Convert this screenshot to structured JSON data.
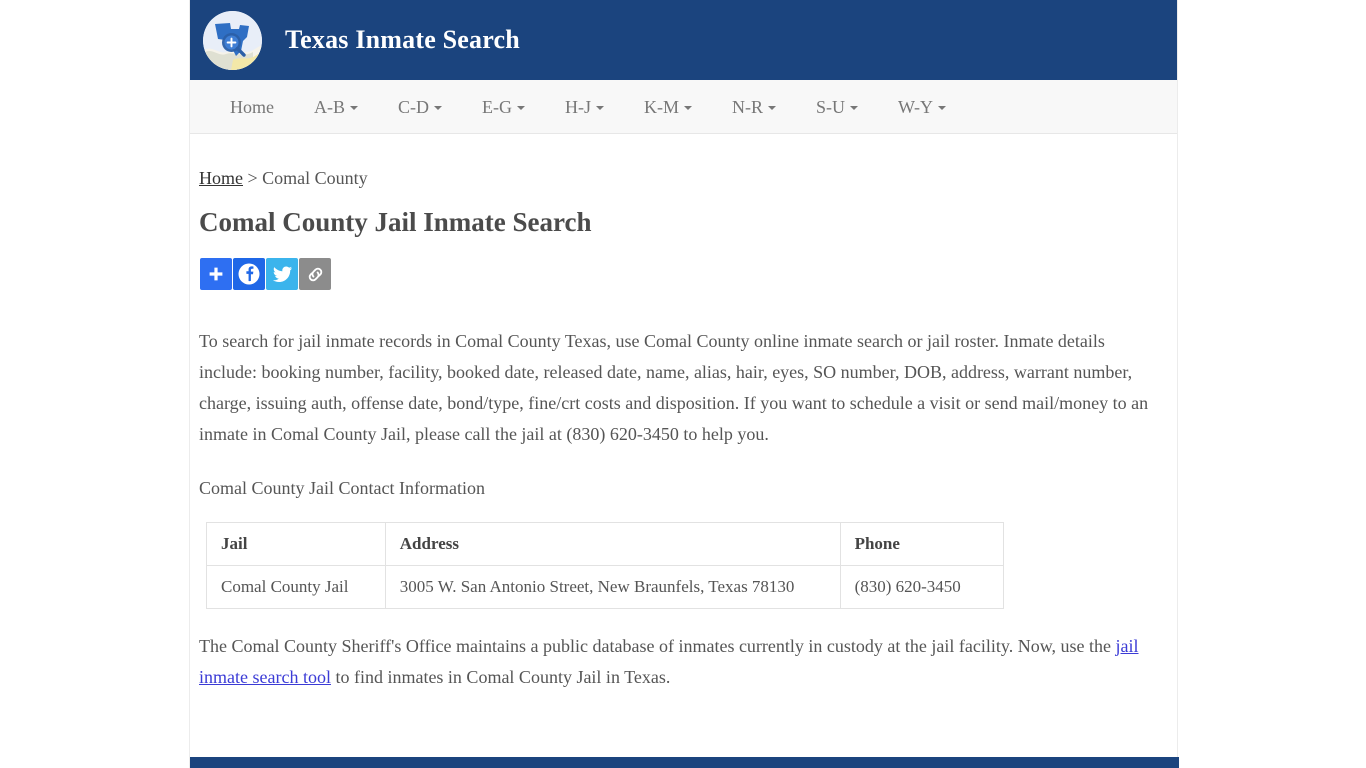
{
  "site": {
    "title": "Texas Inmate Search",
    "logo_icon": "texas-map-magnifier-icon",
    "brand_color": "#1b447e"
  },
  "nav": {
    "items": [
      {
        "label": "Home",
        "has_caret": false
      },
      {
        "label": "A-B",
        "has_caret": true
      },
      {
        "label": "C-D",
        "has_caret": true
      },
      {
        "label": "E-G",
        "has_caret": true
      },
      {
        "label": "H-J",
        "has_caret": true
      },
      {
        "label": "K-M",
        "has_caret": true
      },
      {
        "label": "N-R",
        "has_caret": true
      },
      {
        "label": "S-U",
        "has_caret": true
      },
      {
        "label": "W-Y",
        "has_caret": true
      }
    ]
  },
  "breadcrumb": {
    "home_label": "Home",
    "separator": " > ",
    "current": "Comal County"
  },
  "page": {
    "title": "Comal County Jail Inmate Search"
  },
  "share": {
    "buttons": [
      {
        "name": "addthis-share-button",
        "icon": "plus-icon",
        "color": "#2e6ff2"
      },
      {
        "name": "facebook-share-button",
        "icon": "facebook-icon",
        "color": "#1f67e7"
      },
      {
        "name": "twitter-share-button",
        "icon": "twitter-icon",
        "color": "#3bb4ec"
      },
      {
        "name": "copy-link-button",
        "icon": "chain-link-icon",
        "color": "#8c8c8c"
      }
    ]
  },
  "intro": {
    "paragraph": "To search for jail inmate records in Comal County Texas, use Comal County online inmate search or jail roster. Inmate details include: booking number, facility, booked date, released date, name, alias, hair, eyes, SO number, DOB, address, warrant number, charge, issuing auth, offense date, bond/type, fine/crt costs and disposition. If you want to schedule a visit or send mail/money to an inmate in Comal County Jail, please call the jail at (830) 620-3450 to help you."
  },
  "contact": {
    "heading": "Comal County Jail Contact Information",
    "columns": [
      "Jail",
      "Address",
      "Phone"
    ],
    "rows": [
      {
        "jail": "Comal County Jail",
        "address": "3005 W. San Antonio Street, New Braunfels, Texas 78130",
        "phone": "(830) 620-3450"
      }
    ]
  },
  "outro": {
    "before_link": "The Comal County Sheriff's Office maintains a public database of inmates currently in custody at the jail facility. Now, use the ",
    "link_text": "jail inmate search tool",
    "after_link": " to find inmates in Comal County Jail in Texas."
  }
}
